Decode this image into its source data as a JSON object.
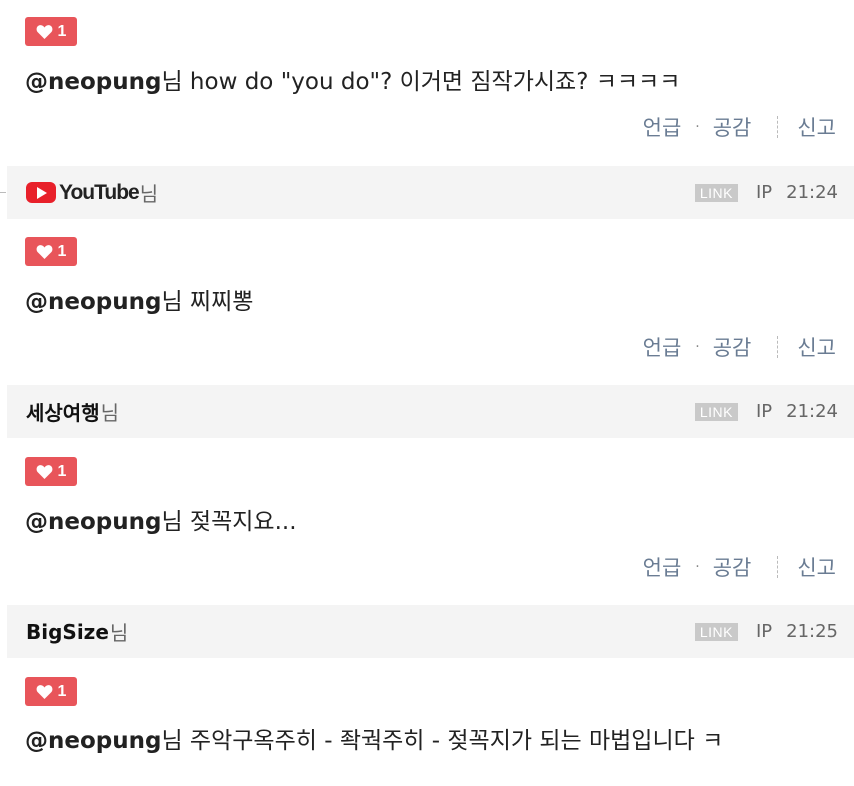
{
  "colors": {
    "like_badge": "#e8555a",
    "action_link": "#6a7c93",
    "author_bar_bg": "#f4f4f4"
  },
  "icons": {
    "like": "heart-icon",
    "youtube": "youtube-logo-icon"
  },
  "actions": {
    "mention": "언급",
    "dot": "·",
    "empathy": "공감",
    "report": "신고"
  },
  "entries": [
    {
      "likes": "1",
      "mention": "@neopung",
      "suffix": "님",
      "text": " how do \"you do\"? 이거면 짐작가시죠? ㅋㅋㅋㅋ"
    },
    {
      "author_logo_text": "YouTube",
      "author_suffix": "님",
      "link_badge": "LINK",
      "ip": "IP",
      "time": "21:24",
      "likes": "1",
      "mention": "@neopung",
      "suffix": "님",
      "text": " 찌찌뽕"
    },
    {
      "author": "세상여행",
      "author_suffix": "님",
      "link_badge": "LINK",
      "ip": "IP",
      "time": "21:24",
      "likes": "1",
      "mention": "@neopung",
      "suffix": "님",
      "text": " 젖꼭지요..."
    },
    {
      "author": "BigSize",
      "author_suffix": "님",
      "link_badge": "LINK",
      "ip": "IP",
      "time": "21:25",
      "likes": "1",
      "mention": "@neopung",
      "suffix": "님",
      "text": " 주악구옥주히 - 좍궉주히 - 젖꼭지가 되는 마법입니다 ㅋ"
    }
  ]
}
